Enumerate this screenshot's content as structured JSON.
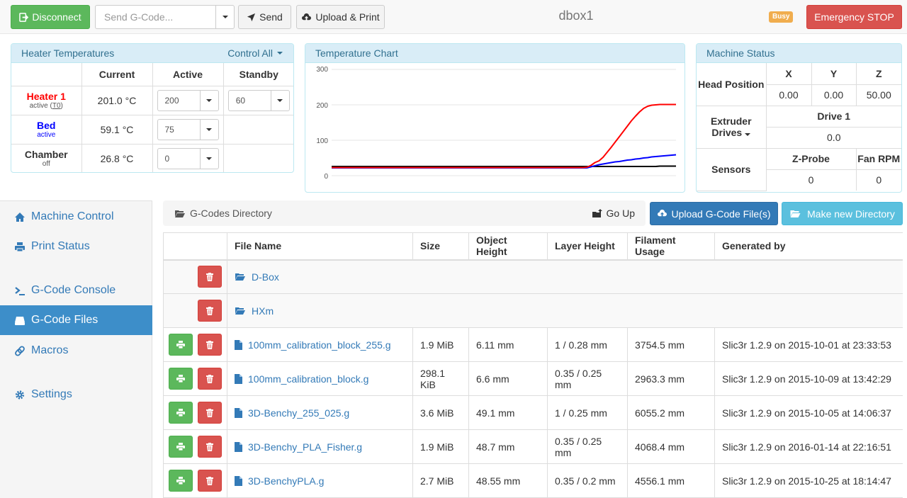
{
  "navbar": {
    "disconnect_label": "Disconnect",
    "gcode_placeholder": "Send G-Code...",
    "send_label": "Send",
    "upload_print_label": "Upload & Print",
    "machine_name": "dbox1",
    "busy_badge": "Busy",
    "emergency_label": "Emergency STOP"
  },
  "heater_panel": {
    "title": "Heater Temperatures",
    "control_all": "Control All",
    "headers": [
      "",
      "Current",
      "Active",
      "Standby"
    ],
    "heaters": [
      {
        "name": "Heater 1",
        "state": "active (",
        "tool": "T0",
        "state_end": ")",
        "current": "201.0 °C",
        "active": "200",
        "standby": "60",
        "color": "#ff0000"
      },
      {
        "name": "Bed",
        "state": "active",
        "current": "59.1 °C",
        "active": "75",
        "color": "#0000ff"
      },
      {
        "name": "Chamber",
        "state": "off",
        "current": "26.8 °C",
        "active": "0",
        "color": "#000000"
      }
    ]
  },
  "chart_panel": {
    "title": "Temperature Chart"
  },
  "chart_data": {
    "type": "line",
    "title": "Temperature Chart",
    "ylim": [
      0,
      300
    ],
    "yticks": [
      "0",
      "100",
      "200",
      "300"
    ],
    "series": [
      {
        "name": "Heater 1",
        "color": "#ff0000",
        "values": [
          23,
          23,
          23,
          23,
          23,
          23,
          23,
          23,
          23,
          23,
          23,
          23,
          23,
          23,
          23,
          23,
          23,
          23,
          23,
          23,
          23,
          23,
          23,
          23,
          23,
          23,
          23,
          23,
          23,
          23,
          23,
          23,
          23,
          23,
          23,
          23,
          23,
          23,
          23,
          23,
          23,
          23,
          23,
          23,
          23,
          23,
          23,
          23,
          23,
          23,
          23,
          23,
          23,
          23,
          23,
          23,
          23,
          23,
          23,
          23,
          23,
          23,
          23,
          24,
          29,
          37,
          42,
          52,
          66,
          80,
          95,
          110,
          125,
          140,
          155,
          168,
          180,
          190,
          196,
          199,
          200,
          201,
          201,
          201,
          201,
          201
        ]
      },
      {
        "name": "Bed",
        "color": "#0000ff",
        "values": [
          22,
          22,
          22,
          22,
          22,
          22,
          22,
          22,
          22,
          22,
          22,
          22,
          22,
          22,
          22,
          22,
          22,
          22,
          22,
          22,
          22,
          22,
          22,
          22,
          22,
          22,
          22,
          22,
          22,
          22,
          22,
          22,
          22,
          22,
          22,
          22,
          22,
          22,
          22,
          22,
          22,
          22,
          22,
          22,
          22,
          22,
          22,
          22,
          22,
          22,
          22,
          22,
          22,
          22,
          22,
          22,
          22,
          22,
          22,
          22,
          22,
          22,
          22,
          22,
          25,
          28,
          31,
          33,
          35,
          37,
          39,
          40,
          42,
          44,
          45,
          47,
          48,
          50,
          51,
          53,
          54,
          55,
          56,
          57,
          58,
          59
        ]
      },
      {
        "name": "Chamber",
        "color": "#000000",
        "values": [
          26,
          26,
          26,
          26,
          26,
          26,
          26,
          26,
          26,
          26,
          26,
          26,
          26,
          26,
          26,
          26,
          26,
          26,
          26,
          26,
          26,
          26,
          26,
          26,
          26,
          26,
          26,
          26,
          26,
          26,
          26,
          26,
          26,
          26,
          26,
          26,
          26,
          26,
          26,
          26,
          26,
          26,
          26,
          26,
          26,
          26,
          26,
          26,
          26,
          26,
          26,
          26,
          26,
          26,
          26,
          26,
          26,
          26,
          26,
          26,
          26,
          26,
          26,
          26,
          26,
          26,
          26,
          26,
          26,
          26,
          26,
          26,
          26,
          26,
          26,
          26,
          26,
          26,
          26,
          26,
          26,
          27,
          27,
          27,
          27,
          27
        ]
      }
    ]
  },
  "status_panel": {
    "title": "Machine Status",
    "head_position_label": "Head Position",
    "axes": [
      "X",
      "Y",
      "Z"
    ],
    "axis_values": [
      "0.00",
      "0.00",
      "50.00"
    ],
    "extruder_label": "Extruder Drives",
    "drive_label": "Drive 1",
    "drive_value": "0.0",
    "sensors_label": "Sensors",
    "zprobe_label": "Z-Probe",
    "zprobe_value": "0",
    "fan_label": "Fan RPM",
    "fan_value": "0"
  },
  "sidebar": {
    "items": [
      {
        "label": "Machine Control",
        "icon": "home-icon"
      },
      {
        "label": "Print Status",
        "icon": "printer-icon"
      },
      {
        "label": "G-Code Console",
        "icon": "terminal-icon"
      },
      {
        "label": "G-Code Files",
        "icon": "hdd-icon",
        "active": true
      },
      {
        "label": "Macros",
        "icon": "link-icon"
      },
      {
        "label": "Settings",
        "icon": "gear-icon"
      }
    ]
  },
  "files": {
    "directory_label": "G-Codes Directory",
    "go_up_label": "Go Up",
    "upload_label": "Upload G-Code File(s)",
    "make_dir_label": "Make new Directory",
    "columns": [
      "",
      "File Name",
      "Size",
      "Object Height",
      "Layer Height",
      "Filament Usage",
      "Generated by"
    ],
    "directories": [
      "D-Box",
      "HXm"
    ],
    "rows": [
      {
        "name": "100mm_calibration_block_255.g",
        "size": "1.9 MiB",
        "object_height": "6.11 mm",
        "layer_height": "1 / 0.28 mm",
        "filament": "3754.5 mm",
        "generated_by": "Slic3r 1.2.9 on 2015-10-01 at 23:33:53"
      },
      {
        "name": "100mm_calibration_block.g",
        "size": "298.1 KiB",
        "object_height": "6.6 mm",
        "layer_height": "0.35 / 0.25 mm",
        "filament": "2963.3 mm",
        "generated_by": "Slic3r 1.2.9 on 2015-10-09 at 13:42:29"
      },
      {
        "name": "3D-Benchy_255_025.g",
        "size": "3.6 MiB",
        "object_height": "49.1 mm",
        "layer_height": "1 / 0.25 mm",
        "filament": "6055.2 mm",
        "generated_by": "Slic3r 1.2.9 on 2015-10-05 at 14:06:37"
      },
      {
        "name": "3D-Benchy_PLA_Fisher.g",
        "size": "1.9 MiB",
        "object_height": "48.7 mm",
        "layer_height": "0.35 / 0.25 mm",
        "filament": "4068.4 mm",
        "generated_by": "Slic3r 1.2.9 on 2016-01-14 at 22:16:51"
      },
      {
        "name": "3D-BenchyPLA.g",
        "size": "2.7 MiB",
        "object_height": "48.55 mm",
        "layer_height": "0.35 / 0.2 mm",
        "filament": "4556.1 mm",
        "generated_by": "Slic3r 1.2.9 on 2015-10-25 at 18:14:47"
      }
    ]
  }
}
